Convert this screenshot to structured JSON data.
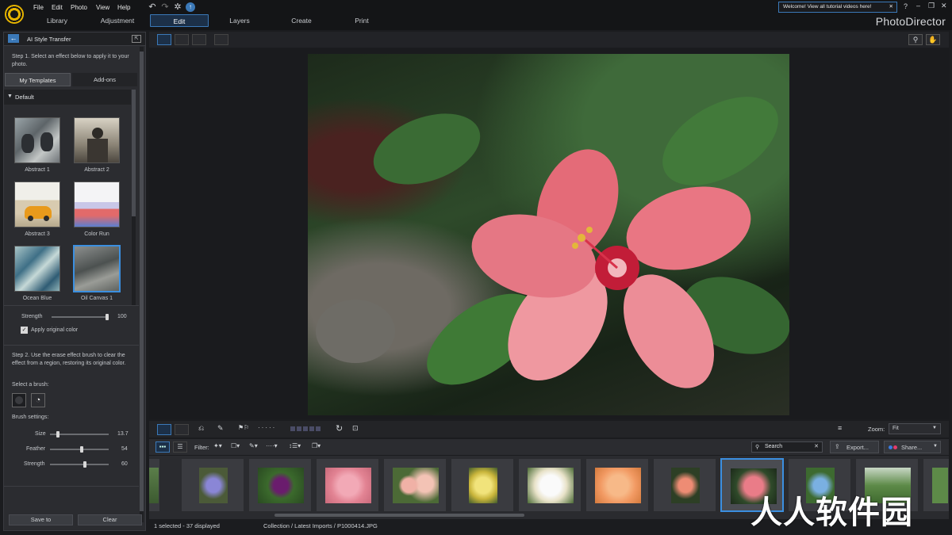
{
  "menu": {
    "file": "File",
    "edit": "Edit",
    "photo": "Photo",
    "view": "View",
    "help": "Help"
  },
  "modes": {
    "library": "Library",
    "adjustment": "Adjustment",
    "edit": "Edit",
    "layers": "Layers",
    "create": "Create",
    "print": "Print"
  },
  "banner": {
    "text": "Welcome! View all tutorial videos here!"
  },
  "brand": "PhotoDirector",
  "panel": {
    "title": "AI Style Transfer",
    "step1": "Step 1. Select an effect below to apply it to your photo.",
    "tabs": {
      "my_templates": "My Templates",
      "addons": "Add-ons"
    },
    "group": "Default",
    "templates": [
      "Abstract 1",
      "Abstract 2",
      "Abstract 3",
      "Color Run",
      "Ocean Blue",
      "Oil Canvas 1"
    ],
    "strength_label": "Strength",
    "strength_value": "100",
    "strength_level": 1.0,
    "apply_original": "Apply original color",
    "step2": "Step 2. Use the erase effect brush to clear the effect from a region, restoring its original color.",
    "select_brush": "Select a brush:",
    "brush_settings": "Brush settings:",
    "brush": {
      "size_label": "Size",
      "size_value": "13.7",
      "size_level": 0.12,
      "feather_label": "Feather",
      "feather_value": "54",
      "feather_level": 0.54,
      "strength_label": "Strength",
      "strength_value": "60",
      "strength_level": 0.6
    },
    "save_label": "Save to",
    "clear_label": "Clear"
  },
  "bottom_toolbar": {
    "zoom_label": "Zoom:",
    "zoom_value": "Fit",
    "filter_label": "Filter:",
    "search_placeholder": "Search",
    "export_label": "Export...",
    "share_label": "Share..."
  },
  "status": {
    "selected": "1 selected - 37 displayed",
    "path": "Collection / Latest Imports / P1000414.JPG"
  },
  "colors": {
    "accent": "#3b79b8",
    "logo": "#e6b400"
  },
  "watermark": "人人软件园"
}
